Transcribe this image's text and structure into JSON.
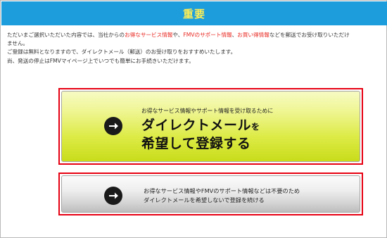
{
  "header": {
    "title": "重要"
  },
  "message": {
    "line1_a": "ただいまご選択いただいた内容では、当社からの",
    "line1_link1": "お得なサービス情報",
    "line1_b": "や、",
    "line1_link2": "FMVのサポート情報",
    "line1_c": "、",
    "line1_link3": "お買い得情報",
    "line1_d": "などを郵送でお受け取りいただけ",
    "line2": "ません。",
    "line3": "ご登録は無料となりますので、ダイレクトメール（郵送）のお受け取りをおすすめいたします。",
    "line4": "尚、発送の停止はFMVマイページ上でいつでも簡単にお手続きいただけます。",
    "highlight_color": "#e8251e"
  },
  "primary_button": {
    "sub_label": "お得なサービス情報やサポート情報を受け取るために",
    "main_label_1": "ダイレクトメール",
    "main_label_1_suffix": "を",
    "main_label_2": "希望して登録する",
    "icon": "arrow-right-circle-icon",
    "accent": "#ddeb46"
  },
  "secondary_button": {
    "line1": "お得なサービス情報やFMVのサポート情報などは不要のため",
    "line2": "ダイレクトメールを希望しないで登録を続ける",
    "icon": "arrow-right-circle-icon"
  },
  "colors": {
    "header_bg": "#1e9ddd",
    "header_text": "#ffee55",
    "button_border_highlight": "#e60012"
  }
}
